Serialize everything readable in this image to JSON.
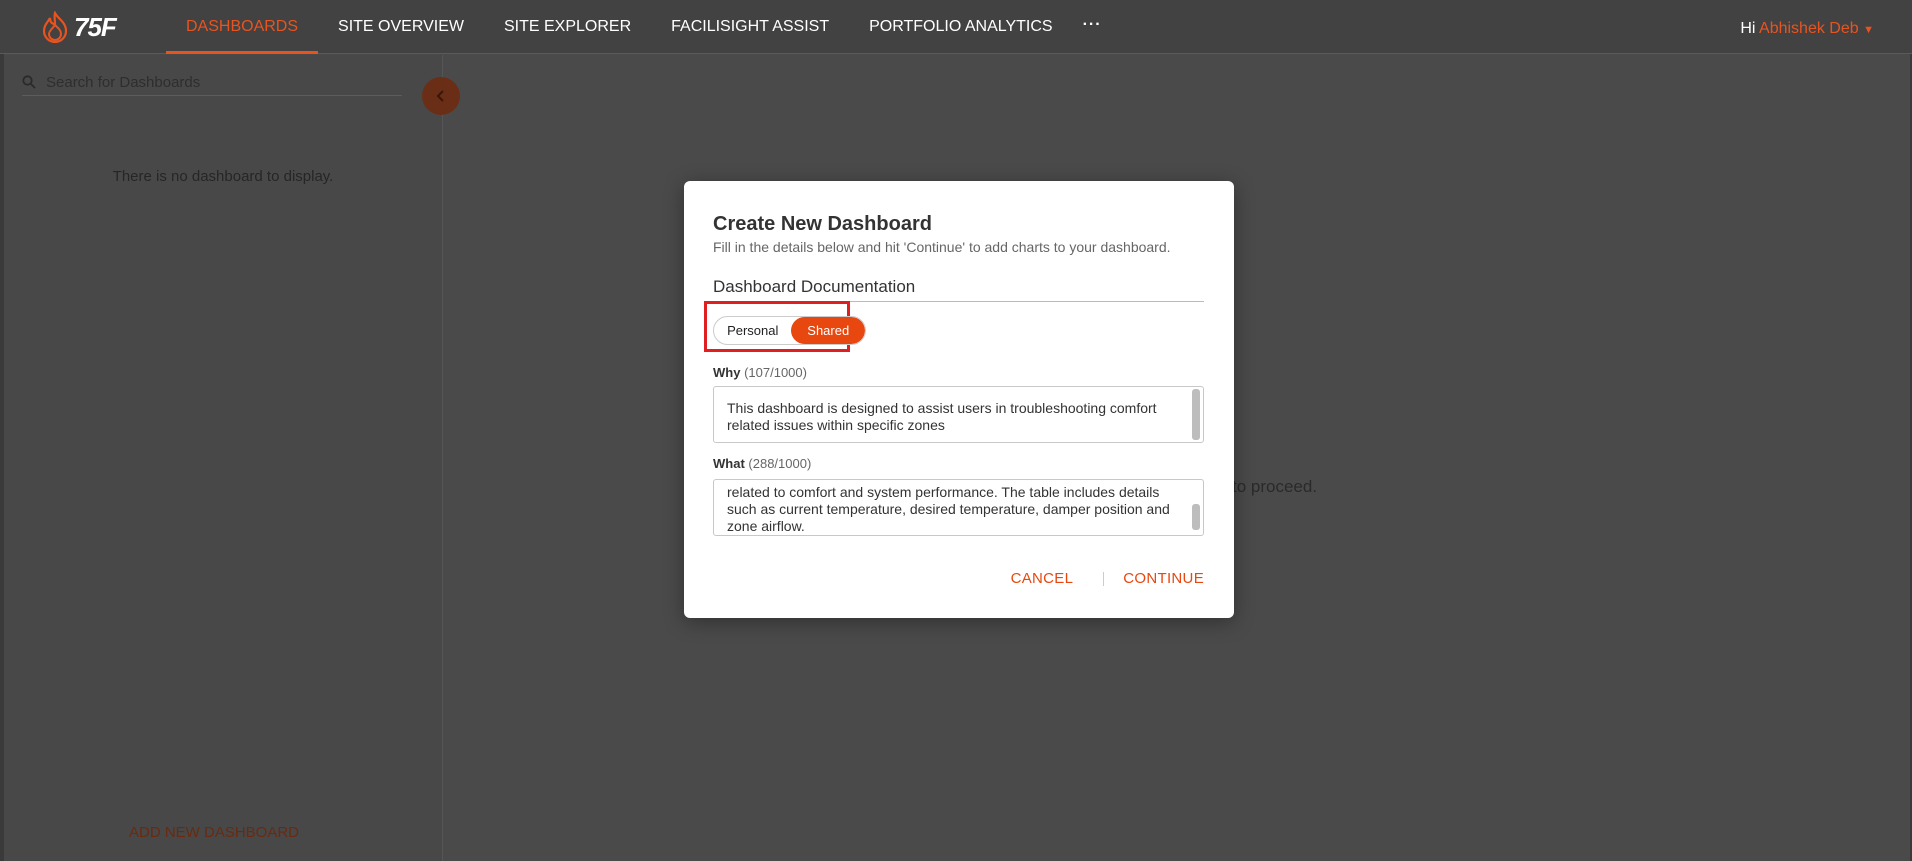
{
  "brand": {
    "logo_text": "75F"
  },
  "nav": {
    "items": [
      {
        "label": "DASHBOARDS",
        "active": true
      },
      {
        "label": "SITE OVERVIEW",
        "active": false
      },
      {
        "label": "SITE EXPLORER",
        "active": false
      },
      {
        "label": "FACILISIGHT ASSIST",
        "active": false
      },
      {
        "label": "PORTFOLIO ANALYTICS",
        "active": false
      }
    ],
    "more_label": "···"
  },
  "user": {
    "greeting": "Hi",
    "name": "Abhishek Deb"
  },
  "sidebar": {
    "search_placeholder": "Search for Dashboards",
    "empty_message": "There is no dashboard to display.",
    "add_label": "ADD NEW DASHBOARD"
  },
  "background_hint": "to proceed.",
  "modal": {
    "title": "Create New Dashboard",
    "subtitle": "Fill in the details below and hit 'Continue' to add charts to your dashboard.",
    "section": "Dashboard Documentation",
    "toggle": {
      "personal": "Personal",
      "shared": "Shared",
      "selected": "Shared"
    },
    "why": {
      "label": "Why",
      "count": "(107/1000)",
      "text": "This dashboard is designed to assist users in troubleshooting comfort related issues within specific zones"
    },
    "what": {
      "label": "What",
      "count": "(288/1000)",
      "text": "related to comfort and system performance. The table includes details such as current temperature, desired temperature, damper position and zone airflow."
    },
    "cancel_label": "CANCEL",
    "continue_label": "CONTINUE"
  },
  "colors": {
    "accent": "#e8470f",
    "highlight": "#e02020",
    "overlay": "#4a4a4a"
  }
}
